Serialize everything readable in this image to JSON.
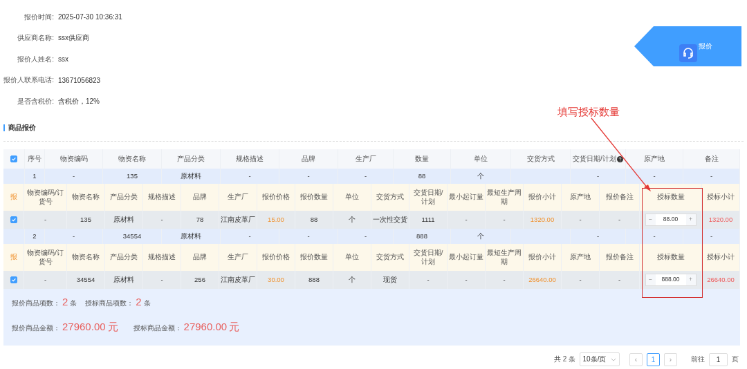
{
  "info": [
    {
      "label": "报价时间:",
      "value": "2025-07-30 10:36:31"
    },
    {
      "label": "供应商名称:",
      "value": "ssx供应商"
    },
    {
      "label": "报价人姓名:",
      "value": "ssx"
    },
    {
      "label": "报价人联系电话:",
      "value": "13671056823"
    },
    {
      "label": "是否含税价:",
      "value": "含税价，12%"
    }
  ],
  "float_button": {
    "label": "报价"
  },
  "annotation": {
    "text": "填写授标数量"
  },
  "section_title": "商品报价",
  "table": {
    "select_all_checked": true,
    "columns": [
      {
        "label": "序号"
      },
      {
        "label": "物资编码"
      },
      {
        "label": "物资名称"
      },
      {
        "label": "产品分类"
      },
      {
        "label": "规格描述"
      },
      {
        "label": "品牌"
      },
      {
        "label": "生产厂"
      },
      {
        "label": "数量"
      },
      {
        "label": "单位"
      },
      {
        "label": "交货方式"
      },
      {
        "label": "交货日期/计划",
        "help": true
      },
      {
        "label": "原产地"
      },
      {
        "label": "备注"
      }
    ],
    "groups": [
      {
        "summary": {
          "index": "1",
          "code": "-",
          "name": "135",
          "category": "原材料",
          "spec": "-",
          "brand": "-",
          "maker": "-",
          "quantity": "88",
          "unit": "个",
          "delivery_date": "-",
          "origin": "-",
          "remark": "-"
        },
        "sub_columns": [
          "报",
          "物资编码/订货号",
          "物资名称",
          "产品分类",
          "规格描述",
          "品牌",
          "生产厂",
          "报价价格",
          "报价数量",
          "单位",
          "交货方式",
          "交货日期/计划",
          "最小起订量",
          "最短生产周期",
          "报价小计",
          "原产地",
          "报价备注",
          "授标数量",
          "授标小计"
        ],
        "checked": true,
        "cells": [
          {
            "kind": "text",
            "text": "-"
          },
          {
            "kind": "text",
            "text": "135"
          },
          {
            "kind": "text",
            "text": "原材料"
          },
          {
            "kind": "text",
            "text": "-"
          },
          {
            "kind": "text",
            "text": "78"
          },
          {
            "kind": "text",
            "text": "江南皮革厂"
          },
          {
            "kind": "price",
            "text": "15.00"
          },
          {
            "kind": "text",
            "text": "88"
          },
          {
            "kind": "text",
            "text": "个"
          },
          {
            "kind": "text",
            "text": "一次性交货"
          },
          {
            "kind": "text",
            "text": "1111"
          },
          {
            "kind": "text",
            "text": "-"
          },
          {
            "kind": "text",
            "text": "-"
          },
          {
            "kind": "price",
            "text": "1320.00"
          },
          {
            "kind": "text",
            "text": "-"
          },
          {
            "kind": "text",
            "text": "-"
          },
          {
            "kind": "stepper",
            "text": "88.00",
            "minus": "−",
            "plus": "+"
          },
          {
            "kind": "awarded",
            "text": "1320.00"
          }
        ]
      },
      {
        "summary": {
          "index": "2",
          "code": "-",
          "name": "34554",
          "category": "原材料",
          "spec": "-",
          "brand": "-",
          "maker": "-",
          "quantity": "888",
          "unit": "个",
          "delivery_date": "-",
          "origin": "-",
          "remark": "-"
        },
        "sub_columns": [
          "报",
          "物资编码/订货号",
          "物资名称",
          "产品分类",
          "规格描述",
          "品牌",
          "生产厂",
          "报价价格",
          "报价数量",
          "单位",
          "交货方式",
          "交货日期/计划",
          "最小起订量",
          "最短生产周期",
          "报价小计",
          "原产地",
          "报价备注",
          "授标数量",
          "授标小计"
        ],
        "checked": true,
        "cells": [
          {
            "kind": "text",
            "text": "-"
          },
          {
            "kind": "text",
            "text": "34554"
          },
          {
            "kind": "text",
            "text": "原材料"
          },
          {
            "kind": "text",
            "text": "-"
          },
          {
            "kind": "text",
            "text": "256"
          },
          {
            "kind": "text",
            "text": "江南皮革厂"
          },
          {
            "kind": "price",
            "text": "30.00"
          },
          {
            "kind": "text",
            "text": "888"
          },
          {
            "kind": "text",
            "text": "个"
          },
          {
            "kind": "text",
            "text": "现货"
          },
          {
            "kind": "text",
            "text": "-"
          },
          {
            "kind": "text",
            "text": "-"
          },
          {
            "kind": "text",
            "text": "-"
          },
          {
            "kind": "price",
            "text": "26640.00"
          },
          {
            "kind": "text",
            "text": "-"
          },
          {
            "kind": "text",
            "text": "-"
          },
          {
            "kind": "stepper",
            "text": "888.00",
            "minus": "−",
            "plus": "+"
          },
          {
            "kind": "awarded",
            "text": "26640.00"
          }
        ]
      }
    ]
  },
  "totals": {
    "rows": [
      [
        {
          "label": "报价商品项数：",
          "value": "2",
          "unit": "条"
        },
        {
          "label": "授标商品项数：",
          "value": "2",
          "unit": "条"
        }
      ],
      [
        {
          "label": "报价商品金额：",
          "value": "27960.00",
          "unit": "元"
        },
        {
          "label": "授标商品金额：",
          "value": "27960.00",
          "unit": "元"
        }
      ]
    ]
  },
  "pagination": {
    "total": "共 2 条",
    "page_size": "10条/页",
    "prev": "‹",
    "next": "›",
    "pages": [
      {
        "label": "1",
        "selected": true
      }
    ],
    "goto_label": "前往",
    "goto_value": "1",
    "goto_suffix": "页"
  }
}
